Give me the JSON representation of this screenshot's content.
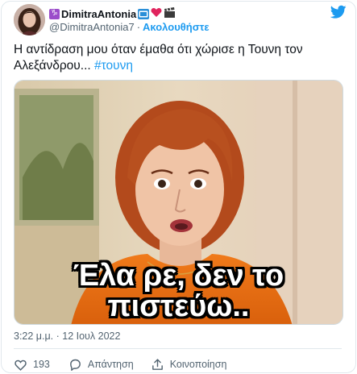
{
  "header": {
    "display_name": "DimitraAntonia",
    "handle": "@DimitraAntonia7",
    "separator": "·",
    "follow_label": "Ακολουθήστε",
    "emoji": [
      "♑",
      "📺",
      "❤",
      "🎬"
    ],
    "icons": [
      "avatar",
      "twitter-bird-icon"
    ]
  },
  "tweet": {
    "text": "Η αντίδραση μου όταν έμαθα ότι χώρισε η Τουνη τον Αλεξάνδρου... ",
    "hashtag": "#τουνη"
  },
  "media": {
    "caption_line1": "Έλα ρε, δεν το",
    "caption_line2": "πιστεύω.."
  },
  "meta": {
    "timestamp": "3:22 μ.μ. · 12 Ιουλ 2022"
  },
  "actions": {
    "like_count": "193",
    "reply_label": "Απάντηση",
    "share_label": "Κοινοποίηση"
  },
  "colors": {
    "accent": "#1d9bf0",
    "like": "#536471",
    "heart": "#e0245e"
  }
}
